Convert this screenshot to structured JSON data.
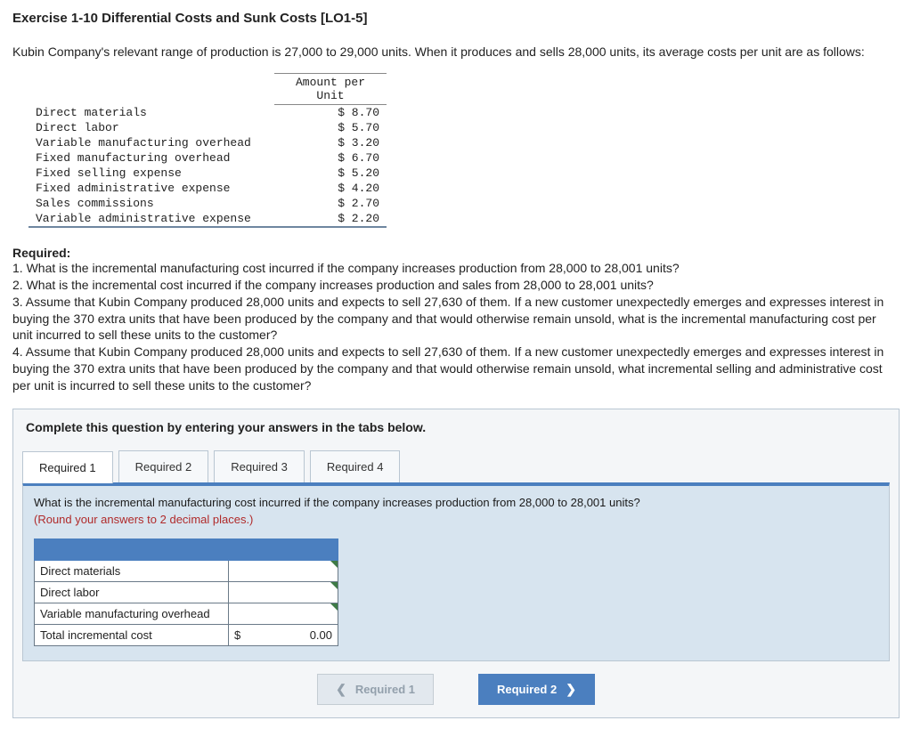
{
  "title": "Exercise 1-10 Differential Costs and Sunk Costs [LO1-5]",
  "intro": "Kubin Company's relevant range of production is 27,000 to 29,000 units. When it produces and sells 28,000 units, its average costs per unit are as follows:",
  "cost_header": "Amount per Unit",
  "costs": [
    {
      "label": "Direct materials",
      "amount": "$ 8.70"
    },
    {
      "label": "Direct labor",
      "amount": "$ 5.70"
    },
    {
      "label": "Variable manufacturing overhead",
      "amount": "$ 3.20"
    },
    {
      "label": "Fixed manufacturing overhead",
      "amount": "$ 6.70"
    },
    {
      "label": "Fixed selling expense",
      "amount": "$ 5.20"
    },
    {
      "label": "Fixed administrative expense",
      "amount": "$ 4.20"
    },
    {
      "label": "Sales commissions",
      "amount": "$ 2.70"
    },
    {
      "label": "Variable administrative expense",
      "amount": "$ 2.20"
    }
  ],
  "required_heading": "Required:",
  "required_items": [
    "1. What is the incremental manufacturing cost incurred if the company increases production from 28,000 to 28,001 units?",
    "2. What is the incremental cost incurred if the company increases production and sales from 28,000 to 28,001 units?",
    "3. Assume that Kubin Company produced 28,000 units and expects to sell 27,630 of them. If a new customer unexpectedly emerges and expresses interest in buying the 370 extra units that have been produced by the company and that would otherwise remain unsold, what is the incremental manufacturing cost per unit incurred to sell these units to the customer?",
    "4. Assume that Kubin Company produced 28,000 units and expects to sell 27,630 of them. If a new customer unexpectedly emerges and expresses interest in buying the 370 extra units that have been produced by the company and that would otherwise remain unsold, what incremental selling and administrative cost per unit is incurred to sell these units to the customer?"
  ],
  "instruct": "Complete this question by entering your answers in the tabs below.",
  "tabs": [
    {
      "label": "Required 1"
    },
    {
      "label": "Required 2"
    },
    {
      "label": "Required 3"
    },
    {
      "label": "Required 4"
    }
  ],
  "tab1": {
    "question": "What is the incremental manufacturing cost incurred if the company increases production from 28,000 to 28,001 units?",
    "note": "(Round your answers to 2 decimal places.)",
    "rows": [
      "Direct materials",
      "Direct labor",
      "Variable manufacturing overhead",
      "Total incremental cost"
    ],
    "currency": "$",
    "total_value": "0.00"
  },
  "nav": {
    "prev": "Required 1",
    "next": "Required 2"
  }
}
